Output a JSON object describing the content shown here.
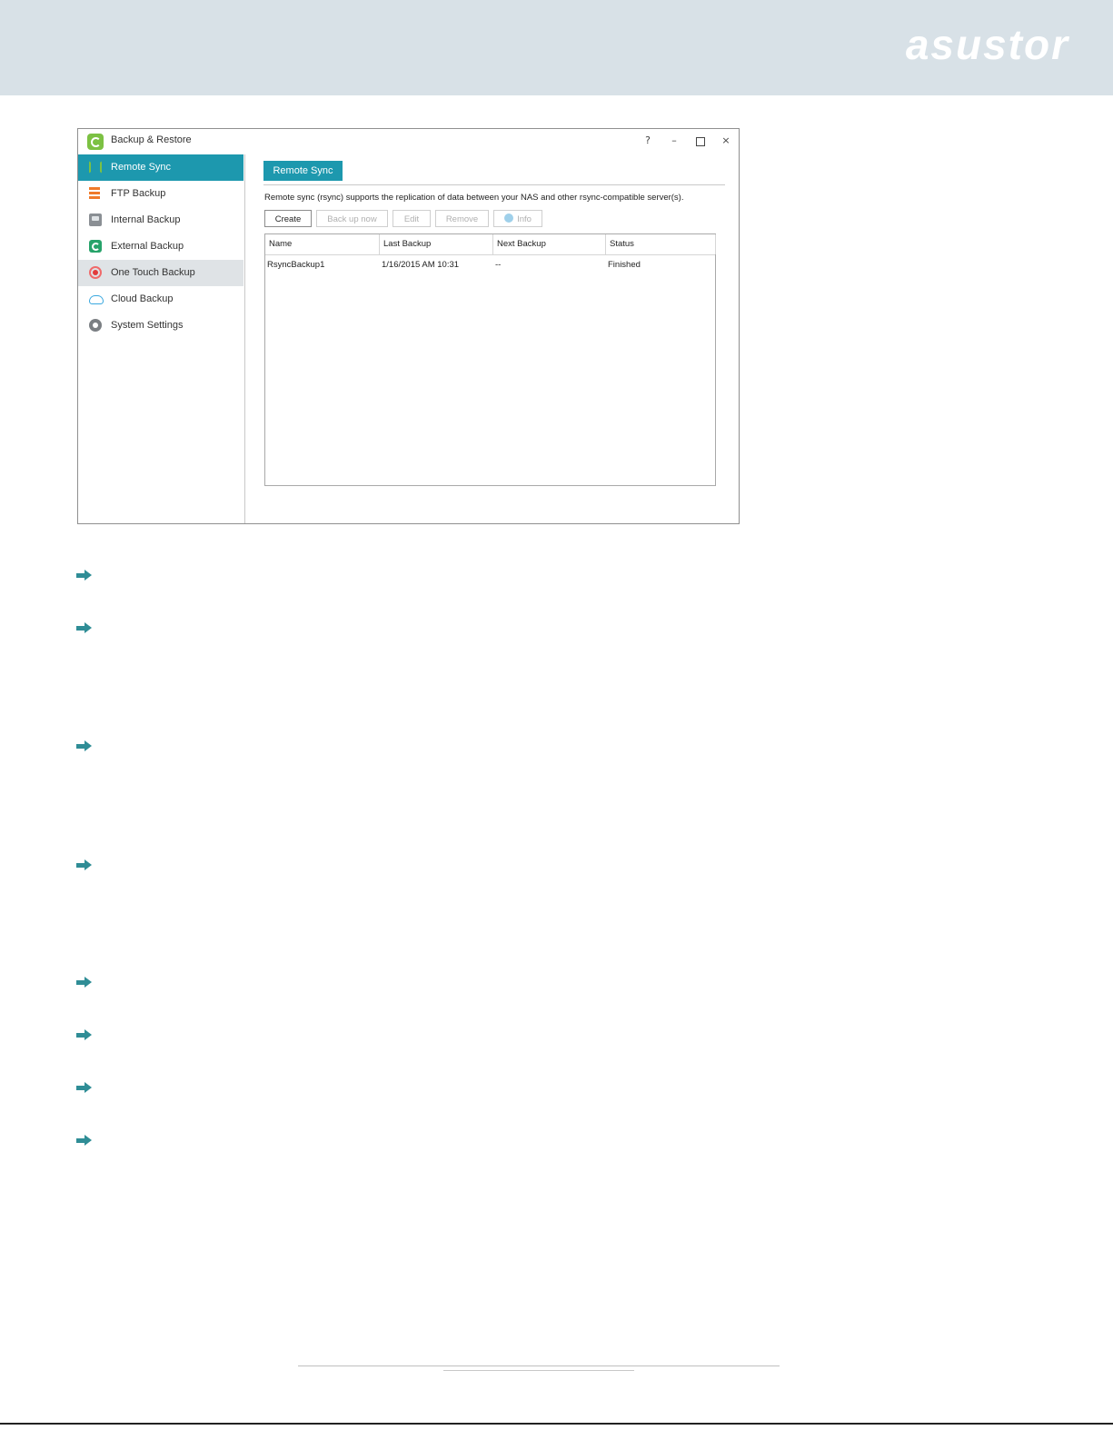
{
  "brand": {
    "logo_text": "asustor"
  },
  "window": {
    "title": "Backup & Restore",
    "controls": {
      "help": "?",
      "minimize": "–",
      "close": "×"
    }
  },
  "sidebar": {
    "items": [
      {
        "label": "Remote Sync",
        "icon": "remote-sync-icon",
        "state": "active"
      },
      {
        "label": "FTP Backup",
        "icon": "ftp-backup-icon"
      },
      {
        "label": "Internal Backup",
        "icon": "internal-backup-icon"
      },
      {
        "label": "External Backup",
        "icon": "external-backup-icon"
      },
      {
        "label": "One Touch Backup",
        "icon": "one-touch-backup-icon",
        "state": "hover"
      },
      {
        "label": "Cloud Backup",
        "icon": "cloud-icon"
      },
      {
        "label": "System Settings",
        "icon": "gear-icon"
      }
    ]
  },
  "main": {
    "tab": "Remote Sync",
    "description": "Remote sync (rsync) supports the replication of data between your NAS and other rsync-compatible server(s).",
    "toolbar": {
      "create": "Create",
      "backup_now": "Back up now",
      "edit": "Edit",
      "remove": "Remove",
      "info": "Info"
    },
    "table": {
      "columns": [
        "Name",
        "Last Backup",
        "Next Backup",
        "Status"
      ],
      "rows": [
        [
          "RsyncBackup1",
          "1/16/2015 AM 10:31",
          "--",
          "Finished"
        ]
      ]
    }
  },
  "colors": {
    "accent": "#1d98ae",
    "banner": "#d8e1e7",
    "arrow": "#2f8d96"
  }
}
